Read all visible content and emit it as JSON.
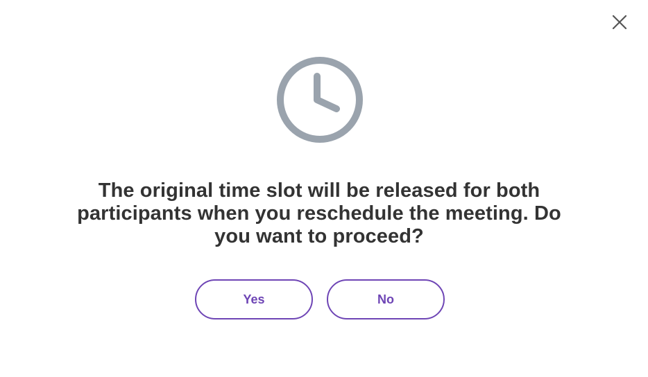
{
  "dialog": {
    "icon": "clock-icon",
    "close_icon": "close-icon",
    "message": "The original time slot will be released for both participants when you reschedule the meeting. Do you want to proceed?",
    "yes_label": "Yes",
    "no_label": "No"
  },
  "colors": {
    "accent": "#6e45b5",
    "icon_gray": "#9aa3ad",
    "text": "#333333",
    "background": "#ffffff"
  }
}
